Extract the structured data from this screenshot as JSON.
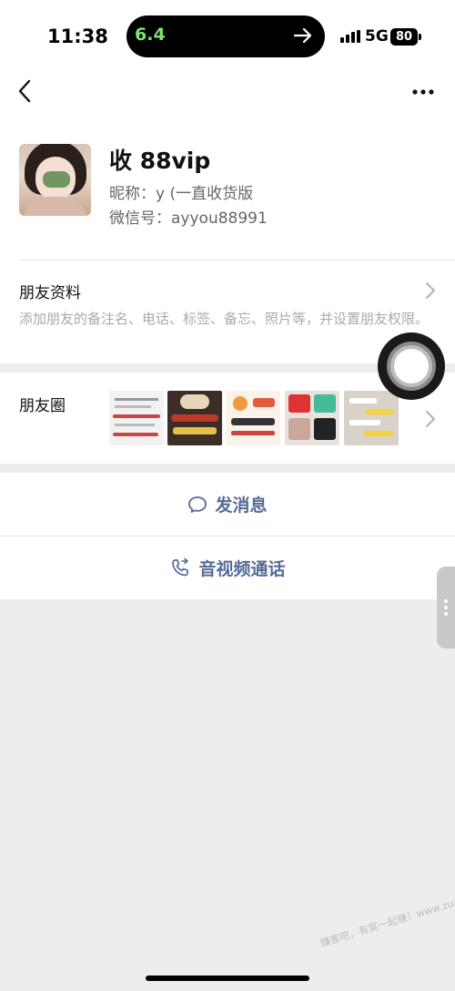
{
  "status_bar": {
    "time": "11:38",
    "island_speed": "6.4",
    "network": "5G",
    "battery": "80"
  },
  "nav": {
    "back_icon": "chevron-left-icon",
    "more_icon": "ellipsis-icon"
  },
  "profile": {
    "name": "收 88vip",
    "nickname": "昵称：y (一直收货版",
    "wechat_id": "微信号：ayyou88991"
  },
  "friend_info": {
    "title": "朋友资料",
    "description": "添加朋友的备注名、电话、标签、备忘、照片等，并设置朋友权限。"
  },
  "moments": {
    "title": "朋友圈",
    "thumbnail_count": 5
  },
  "actions": {
    "message_label": "发消息",
    "call_label": "音视频通话"
  },
  "watermark": "赚客吧，有奖一起赚！www.zuanke8.com",
  "colors": {
    "link": "#576b95",
    "background": "#ededed",
    "card": "#ffffff"
  }
}
